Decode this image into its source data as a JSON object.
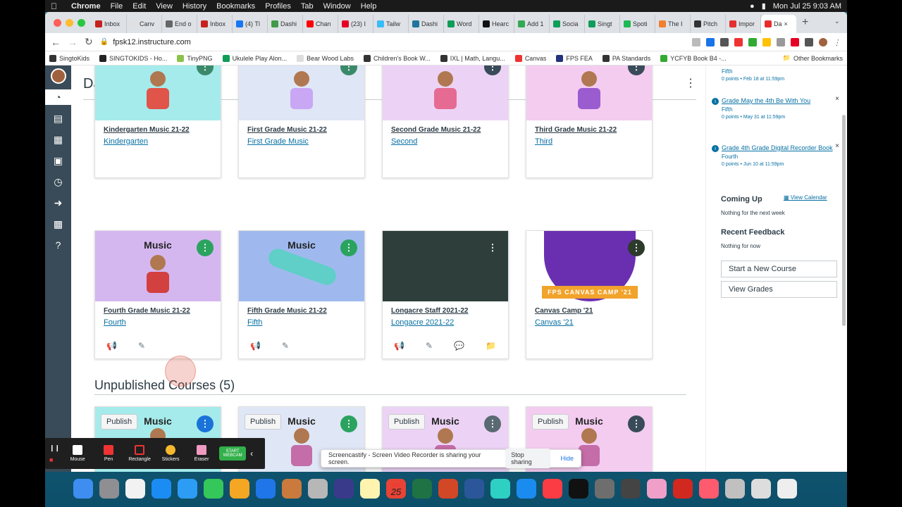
{
  "os": {
    "menubar": {
      "app": "Chrome",
      "items": [
        "File",
        "Edit",
        "View",
        "History",
        "Bookmarks",
        "Profiles",
        "Tab",
        "Window",
        "Help"
      ],
      "datetime": "Mon Jul 25  9:03 AM"
    }
  },
  "browser": {
    "tabs": [
      "Inbox",
      "Canv",
      "End o",
      "Inbox",
      "(4) Tl",
      "Dashi",
      "Chan",
      "(23) I",
      "Tailw",
      "Dashi",
      "Word",
      "Hearc",
      "Add 1",
      "Socia",
      "Singt",
      "Spoti",
      "The I",
      "Pitch",
      "Impor",
      "Da"
    ],
    "tab_colors": [
      "#c5221f",
      "#e0e0e0",
      "#666",
      "#c5221f",
      "#1877f2",
      "#3f9b48",
      "#ff0000",
      "#e60023",
      "#38bdf8",
      "#21759b",
      "#0f9d58",
      "#111",
      "#34a853",
      "#0f9d58",
      "#0f9d58",
      "#1db954",
      "#f08030",
      "#333",
      "#e62e2e",
      "#e62e2e"
    ],
    "url": "fpsk12.instructure.com",
    "bookmarks": [
      "SingtoKids",
      "SINGTOKIDS - Ho...",
      "TinyPNG",
      "Ukulele Play Alon...",
      "Bear Wood Labs",
      "Children's Book W...",
      "IXL | Math, Langu...",
      "Canvas",
      "FPS FEA",
      "PA Standards",
      "YCFYB Book B4 -..."
    ],
    "other_bookmarks": "Other Bookmarks"
  },
  "page": {
    "title": "Dashboard",
    "published_courses": [
      {
        "name": "Kindergarten Music 21-22",
        "term": "Kindergarten",
        "color": "#a5ebeb",
        "dot": "#3a8a6a"
      },
      {
        "name": "First Grade Music 21-22",
        "term": "First Grade Music",
        "color": "#dfe6f5",
        "dot": "#3a8a6a"
      },
      {
        "name": "Second Grade Music 21-22",
        "term": "Second",
        "color": "#ecd3f5",
        "dot": "#394b58"
      },
      {
        "name": "Third Grade Music 21-22",
        "term": "Third",
        "color": "#f3ccf0",
        "dot": "#394b58"
      },
      {
        "name": "Fourth Grade Music 21-22",
        "term": "Fourth",
        "color": "#d5b7f0",
        "dot": "#2aa35f",
        "music": "Music"
      },
      {
        "name": "Fifth Grade Music 21-22",
        "term": "Fifth",
        "color": "#9fb9ef",
        "dot": "#2aa35f",
        "music": "Music"
      },
      {
        "name": "Longacre Staff 2021-22",
        "term": "Longacre 2021-22",
        "color": "#2e3e3a",
        "dot": "#2e3e3a"
      },
      {
        "name": "Canvas Camp '21",
        "term": "Canvas '21",
        "color": "#ffffff",
        "dot": "#2d3b2d",
        "camp": "FPS CANVAS CAMP '21"
      }
    ],
    "unpublished_heading": "Unpublished Courses (5)",
    "unpublished_courses": [
      {
        "music": "Music",
        "publish": "Publish",
        "color": "#a5ebeb",
        "dot": "#1a73d8"
      },
      {
        "music": "Music",
        "publish": "Publish",
        "color": "#dfe6f5",
        "dot": "#2aa35f"
      },
      {
        "music": "Music",
        "publish": "Publish",
        "color": "#ecd3f5",
        "dot": "#5a6a72"
      },
      {
        "music": "Music",
        "publish": "Publish",
        "color": "#f3ccf0",
        "dot": "#394b58"
      }
    ]
  },
  "sidebar": {
    "todo": [
      {
        "title": "Fifth",
        "course": "",
        "due": "0 points • Feb 18 at 11:59pm"
      },
      {
        "title": "Grade May the 4th Be With You",
        "course": "Fifth",
        "due": "0 points • May 31 at 11:59pm"
      },
      {
        "title": "Grade 4th Grade Digital Recorder Book",
        "course": "Fourth",
        "due": "0 points • Jun 10 at 11:59pm"
      }
    ],
    "coming_up": "Coming Up",
    "view_calendar": "View Calendar",
    "nothing_next_week": "Nothing for the next week",
    "recent_feedback": "Recent Feedback",
    "nothing_now": "Nothing for now",
    "start_course": "Start a New Course",
    "view_grades": "View Grades"
  },
  "overlay": {
    "annotate_tools": [
      "Mouse",
      "Pen",
      "Rectangle",
      "Stickers",
      "Eraser",
      "START WEBCAM"
    ],
    "share_message": "Screencastify - Screen Video Recorder is sharing your screen.",
    "stop_sharing": "Stop sharing",
    "hide": "Hide"
  },
  "dock": {
    "calendar_month": "JUL",
    "calendar_day": "25",
    "icon_colors": [
      "#3d8ef0",
      "#8e8e93",
      "#f2f2f2",
      "#1c8cf5",
      "#2d9cf4",
      "#34c759",
      "#f5a623",
      "#1f76e8",
      "#c97a3c",
      "#b7b7b7",
      "#3a3a8a",
      "#fff3b0",
      "#e84335",
      "#1f7244",
      "#d24726",
      "#2b579a",
      "#2ed0c4",
      "#1a8cf0",
      "#fc3c44",
      "#111",
      "#6e6e6e",
      "#444",
      "#f0a0c8",
      "#d1281f",
      "#ff5b6e",
      "#c0c0c0",
      "#ddd",
      "#eee"
    ]
  }
}
